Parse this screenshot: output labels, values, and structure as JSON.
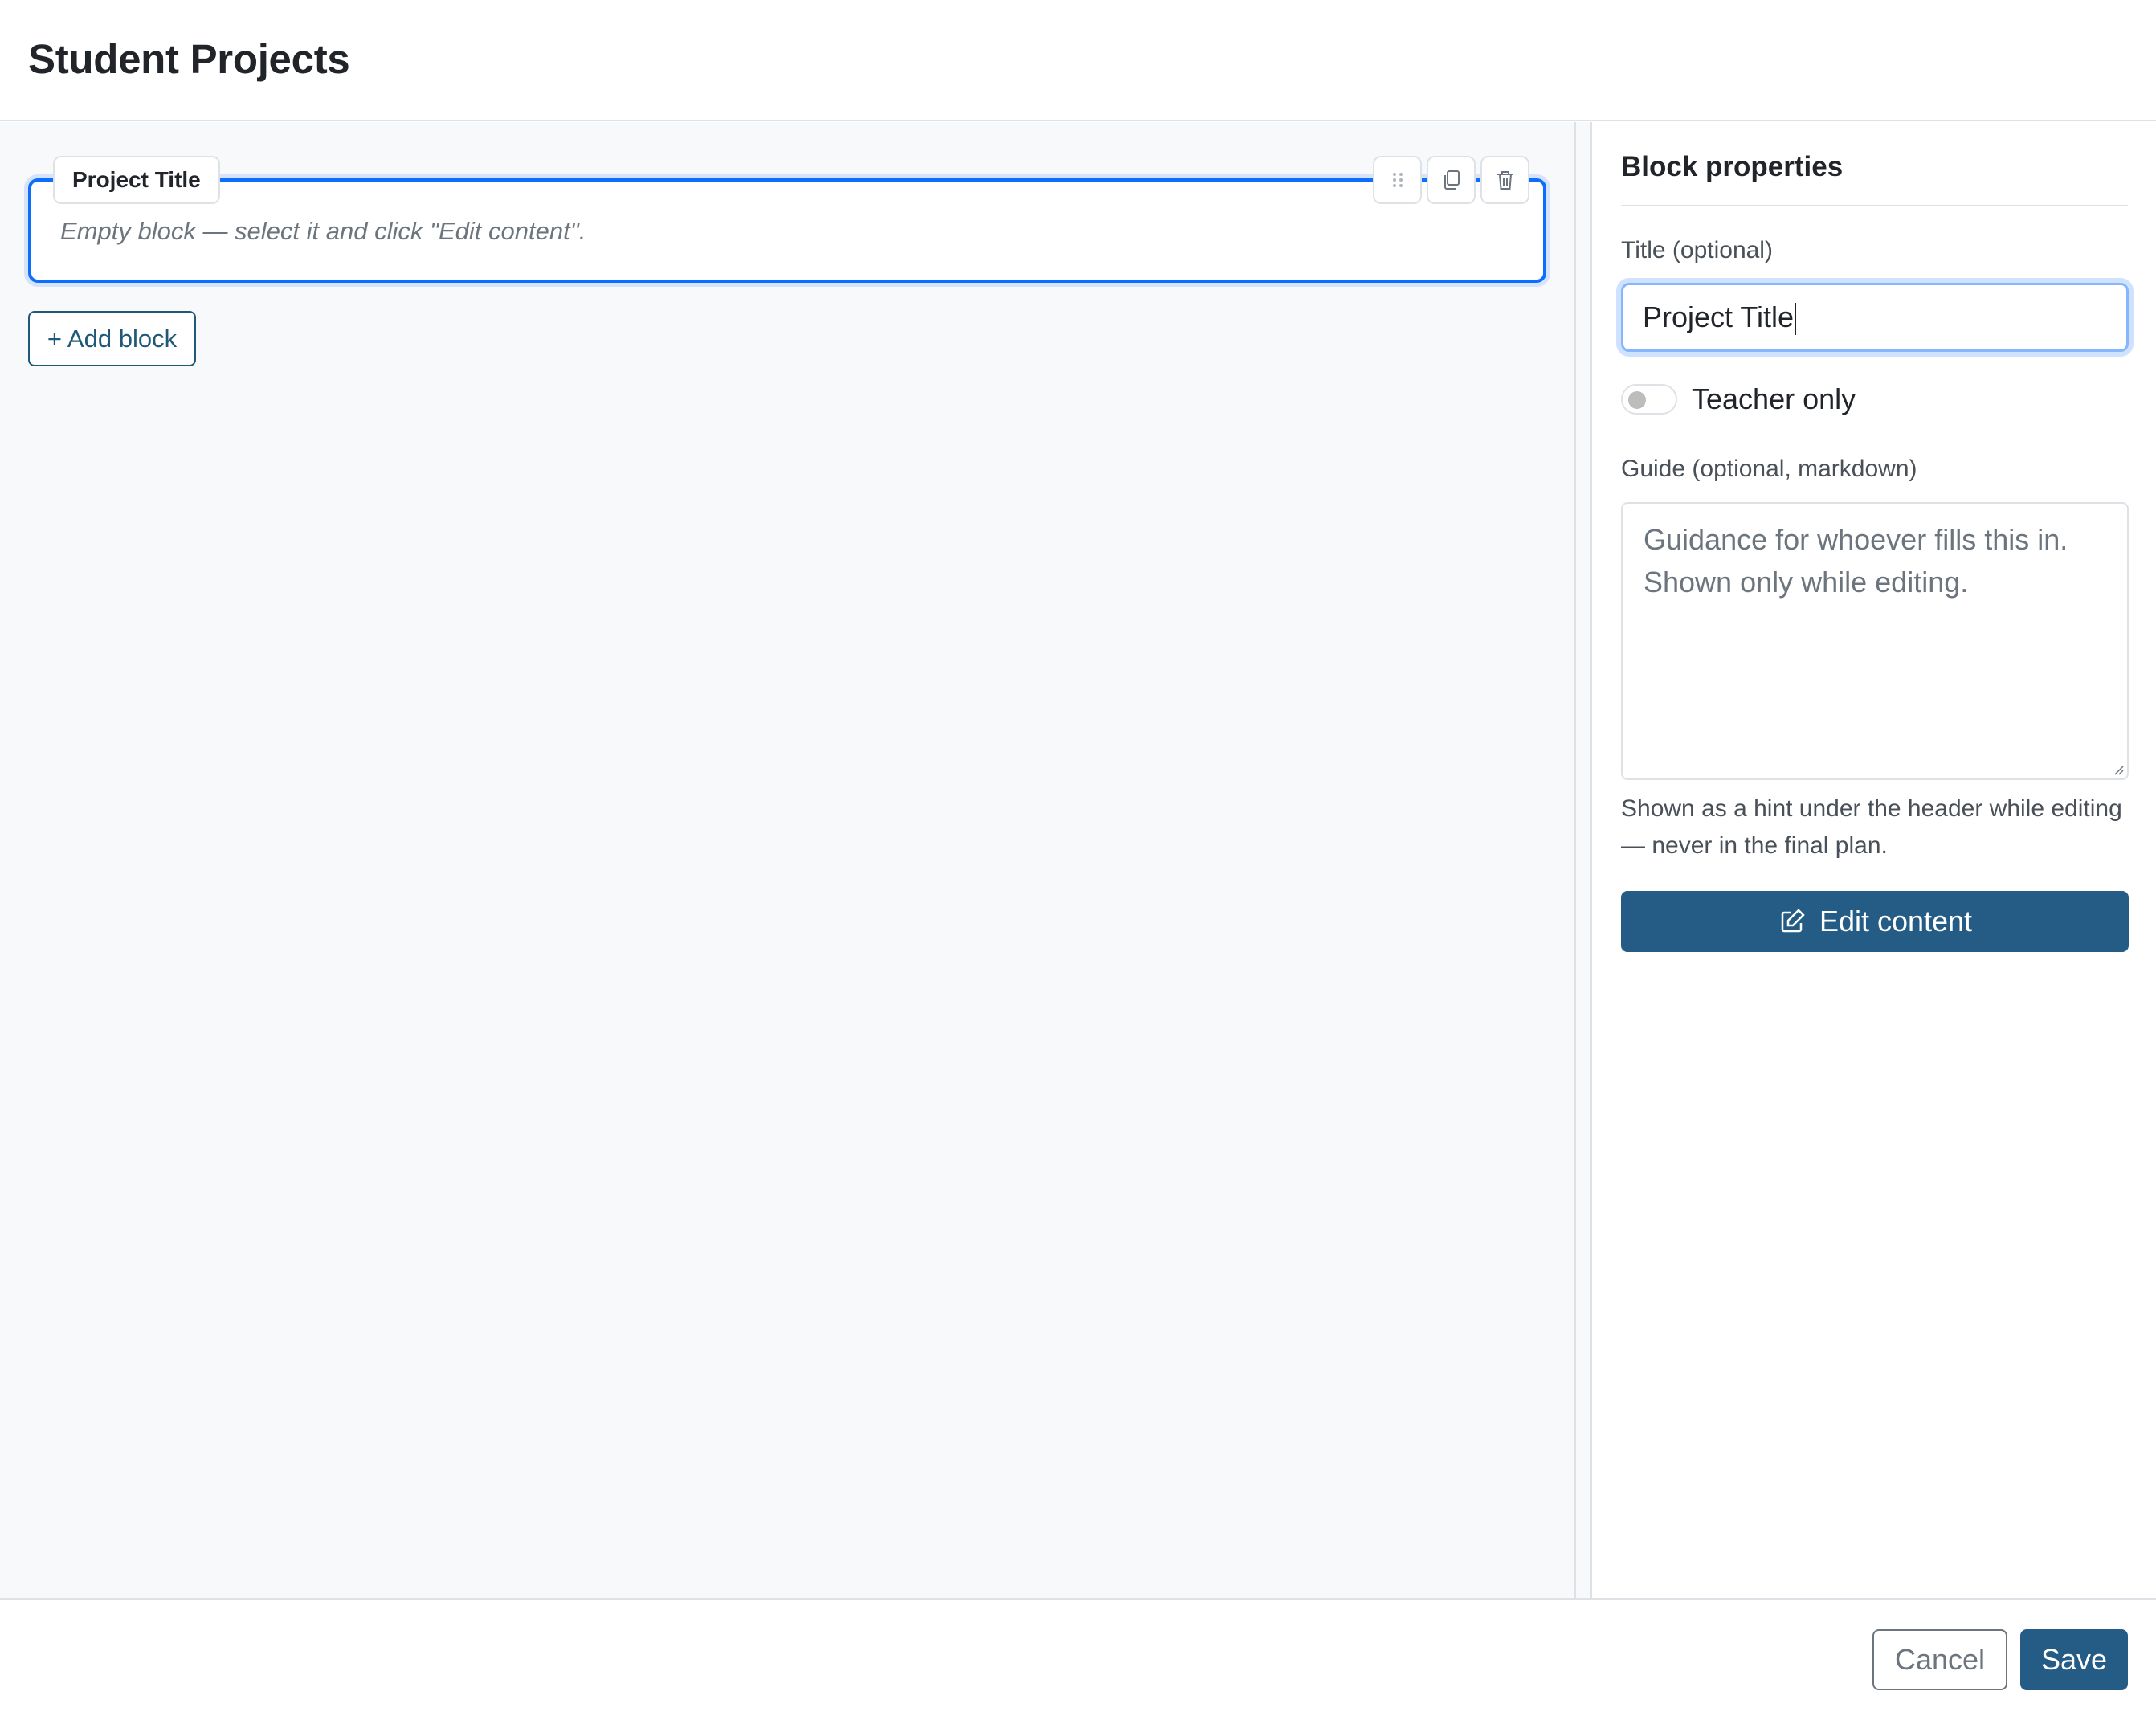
{
  "header": {
    "title": "Student Projects"
  },
  "canvas": {
    "block": {
      "title": "Project Title",
      "empty_text": "Empty block — select it and click \"Edit content\".",
      "tools": [
        {
          "icon": "drag-handle-icon"
        },
        {
          "icon": "copy-icon"
        },
        {
          "icon": "trash-icon"
        }
      ]
    },
    "add_block_label": "+ Add block"
  },
  "properties": {
    "heading": "Block properties",
    "title_label": "Title (optional)",
    "title_value": "Project Title",
    "teacher_only_label": "Teacher only",
    "teacher_only_on": false,
    "guide_label": "Guide (optional, markdown)",
    "guide_placeholder": "Guidance for whoever fills this in. Shown only while editing.",
    "guide_hint": "Shown as a hint under the header while editing — never in the final plan.",
    "edit_content_label": "Edit content"
  },
  "footer": {
    "cancel_label": "Cancel",
    "save_label": "Save"
  },
  "colors": {
    "accent": "#0d6efd",
    "primary_button": "#245c85",
    "outline_link": "#1f5878",
    "canvas_bg": "#f8f9fa"
  }
}
